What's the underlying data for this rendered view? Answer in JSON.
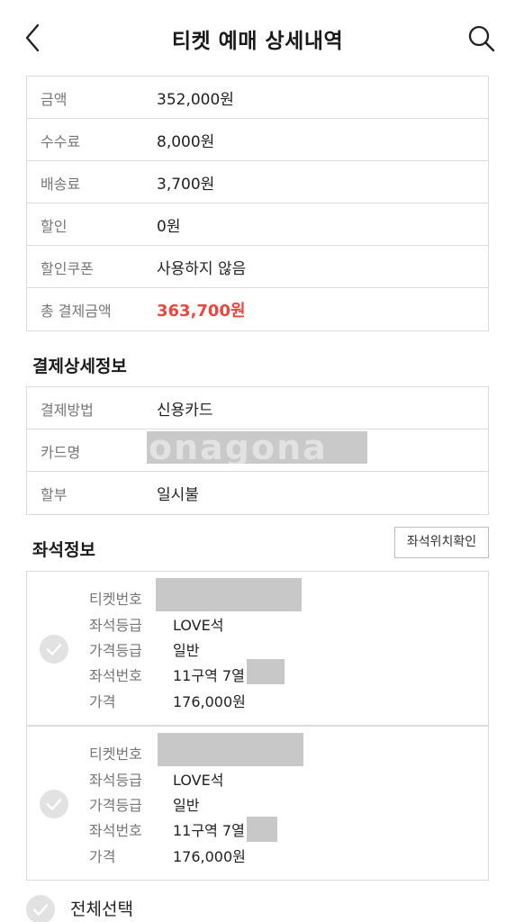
{
  "header": {
    "title": "티켓 예매 상세내역",
    "back_icon": "chevron-left-icon",
    "search_icon": "search-icon"
  },
  "payment_summary": [
    {
      "label": "금액",
      "value": "352,000원"
    },
    {
      "label": "수수료",
      "value": "8,000원"
    },
    {
      "label": "배송료",
      "value": "3,700원"
    },
    {
      "label": "할인",
      "value": "0원"
    },
    {
      "label": "할인쿠폰",
      "value": "사용하지 않음"
    },
    {
      "label": "총 결제금액",
      "value": "363,700원"
    }
  ],
  "payment_detail": {
    "title": "결제상세정보",
    "rows": [
      {
        "label": "결제방법",
        "value": "신용카드"
      },
      {
        "label": "카드명",
        "value": ""
      },
      {
        "label": "할부",
        "value": "일시불"
      }
    ]
  },
  "seat_info": {
    "title": "좌석정보",
    "check_location_button": "좌석위치확인",
    "tickets": [
      {
        "ticket_number_label": "티켓번호",
        "grade_label": "좌석등급",
        "grade": "LOVE석",
        "price_grade_label": "가격등급",
        "price_grade": "일반",
        "seat_number_label": "좌석번호",
        "seat_number": "11구역 7열",
        "price_label": "가격",
        "price": "176,000원"
      },
      {
        "ticket_number_label": "티켓번호",
        "grade_label": "좌석등급",
        "grade": "LOVE석",
        "price_grade_label": "가격등급",
        "price_grade": "일반",
        "seat_number_label": "좌석번호",
        "seat_number": "11구역 7열",
        "price_label": "가격",
        "price": "176,000원"
      }
    ]
  },
  "select_all": {
    "label": "전체선택"
  },
  "watermark_text": "onagona",
  "colors": {
    "accent_total": "#e9463f",
    "border": "#dcdcdc",
    "label_gray": "#777777",
    "redaction": "#c8c8c8",
    "check_circle": "#e2e2e2"
  }
}
